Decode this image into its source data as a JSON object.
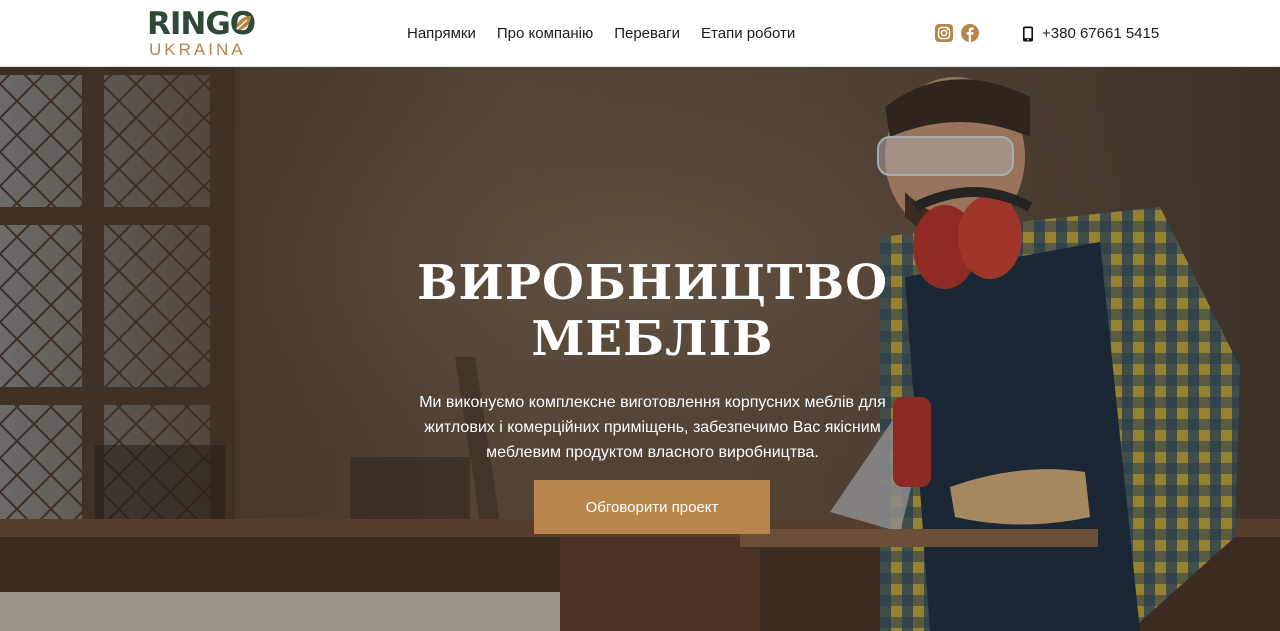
{
  "header": {
    "logo": {
      "top": "RINGO",
      "bottom": "UKRAINA"
    },
    "nav": [
      {
        "label": "Напрямки"
      },
      {
        "label": "Про компанію"
      },
      {
        "label": "Переваги"
      },
      {
        "label": "Етапи роботи"
      }
    ],
    "social": {
      "instagram_icon": "instagram-icon",
      "facebook_icon": "facebook-icon"
    },
    "phone": "+380 67661 5415"
  },
  "hero": {
    "title_line1": "ВИРОБНИЦТВО",
    "title_line2": "МЕБЛІВ",
    "subtitle": "Ми виконуємо комплексне виготовлення корпусних меблів для житлових і комерційних приміщень, забезпечимо Вас якісним меблевим продуктом власного виробництва.",
    "cta_label": "Обговорити проект"
  },
  "colors": {
    "accent": "#b9874b",
    "logo_green": "#2f4a36",
    "text_dark": "#1c1c1c"
  }
}
